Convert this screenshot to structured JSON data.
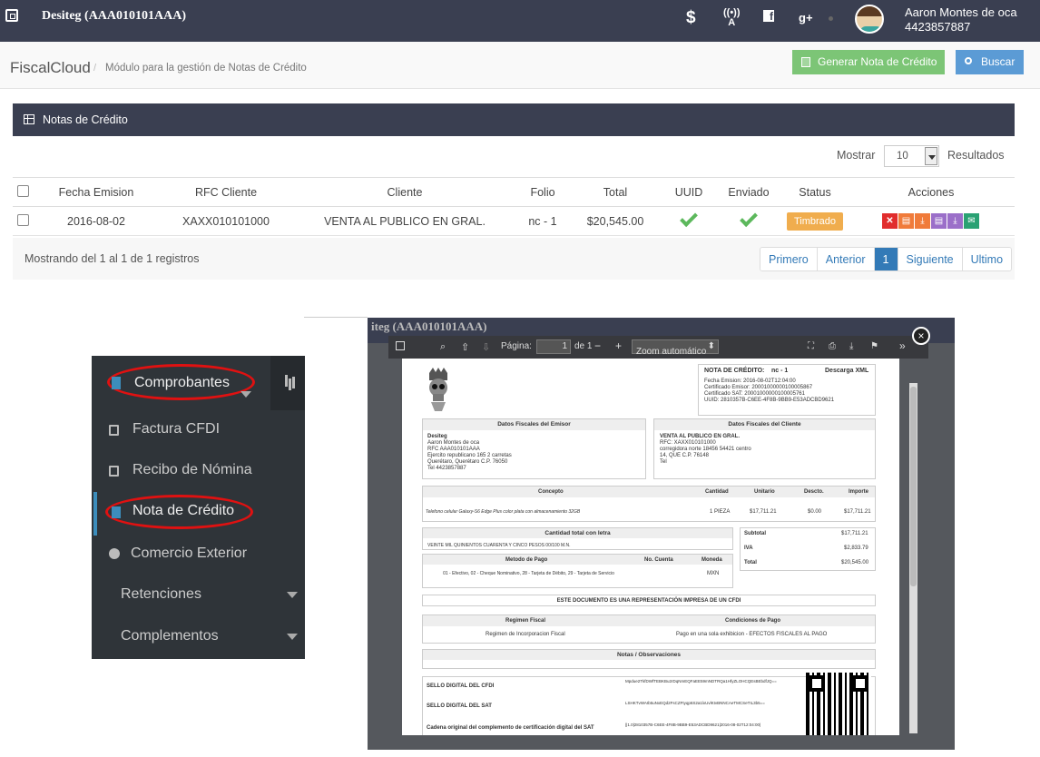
{
  "header": {
    "company": "Desiteg  (AAA010101AAA)",
    "user_name": "Aaron Montes de oca",
    "user_phone": "4423857887",
    "icons": [
      "expand-icon",
      "dollar-icon",
      "accessibility-icon",
      "facebook-icon",
      "google-plus-icon",
      "avatar"
    ]
  },
  "breadcrumb": {
    "app": "FiscalCloud",
    "sep": "/",
    "module": "Módulo para la gestión de Notas de Crédito"
  },
  "actions": {
    "generate": "Generar Nota de Crédito",
    "search": "Buscar"
  },
  "panel": {
    "title": "Notas de Crédito"
  },
  "length": {
    "label_before": "Mostrar",
    "value": "10",
    "label_after": "Resultados"
  },
  "table": {
    "columns": [
      "Fecha Emision",
      "RFC Cliente",
      "Cliente",
      "Folio",
      "Total",
      "UUID",
      "Enviado",
      "Status",
      "Acciones"
    ],
    "rows": [
      {
        "fecha": "2016-08-02",
        "rfc": "XAXX010101000",
        "cliente": "VENTA AL PUBLICO EN GRAL.",
        "folio": "nc - 1",
        "total": "$20,545.00",
        "status": "Timbrado"
      }
    ]
  },
  "info": "Mostrando del 1 al 1 de 1 registros",
  "pagination": [
    "Primero",
    "Anterior",
    "1",
    "Siguiente",
    "Ultimo"
  ],
  "sidebar": {
    "items": [
      "Comprobantes",
      "Factura CFDI",
      "Recibo de Nómina",
      "Nota de Crédito",
      "Comercio Exterior",
      "Retenciones",
      "Complementos"
    ]
  },
  "pdf_viewer": {
    "bg_title": "iteg  (AAA010101AAA)",
    "page_label": "Página:",
    "page_value": "1",
    "page_of": "de 1",
    "zoom": "Zoom automático",
    "close": "×"
  },
  "pdf_doc": {
    "nota_label": "NOTA DE CRÉDITO:",
    "nota_value": "nc - 1",
    "download": "Descarga XML",
    "fecha": "Fecha Emision: 2016-08-02T12:04:00",
    "cert_emisor": "Certificado Emisor: 20001000000100005867",
    "cert_sat": "Certificado SAT: 20001000000100005761",
    "uuid": "UUID: 2810357B-C6EE-4F8B-9BB9-E53ADCBD9621",
    "emisor_title": "Datos Fiscales del Emisor",
    "emisor_lines": [
      "Desiteg",
      "Aaron Montes de oca",
      "RFC AAA010101AAA",
      "Ejercito republicano 165 2 carretas",
      "Querétaro, Querétaro C.P. 76050",
      "Tel 4423857887"
    ],
    "cliente_title": "Datos Fiscales del Cliente",
    "cliente_lines": [
      "VENTA AL PUBLICO EN GRAL.",
      "RFC: XAXX010101000",
      "corregidora norte 18456 54421 centro",
      "14, QUE C.P. 76148",
      "Tel"
    ],
    "concept_headers": [
      "Concepto",
      "Cantidad",
      "Unitario",
      "Descto.",
      "Importe"
    ],
    "concept_row": [
      "Telefono celular Galaxy-S6 Edge Plus color plata con almacenamiento 32GB",
      "1 PIEZA",
      "$17,711.21",
      "$0.00",
      "$17,711.21"
    ],
    "letra_title": "Cantidad total con letra",
    "letra": "VEINTE MIL QUINIENTOS CUARENTA Y CINCO PESOS 00/100 M.N.",
    "subtotal_label": "Subtotal",
    "subtotal": "$17,711.21",
    "iva_label": "IVA",
    "iva": "$2,833.79",
    "total_label": "Total",
    "total": "$20,545.00",
    "pago_headers": [
      "Metodo de Pago",
      "No. Cuenta",
      "Moneda"
    ],
    "pago_row": [
      "01 - Efectivo, 02 - Cheque Nominativo, 28 - Tarjeta de Débito, 29 - Tarjeta de Servicio",
      "",
      "MXN"
    ],
    "representacion": "ESTE DOCUMENTO ES UNA REPRESENTACIÓN IMPRESA DE UN CFDI",
    "regimen_title": "Regimen Fiscal",
    "regimen": "Regimen de Incorporacion Fiscal",
    "condiciones_title": "Condiciones de Pago",
    "condiciones": "Pago en una sola exhibicion - EFECTOS FISCALES AL PAGO",
    "notas_title": "Notas / Observaciones",
    "sello_cfdi": "SELLO DIGITAL DEL CFDI",
    "sello_sat": "SELLO DIGITAL DEL SAT",
    "cadena": "Cadena original del complemento de certificación digital del SAT",
    "sello_cfdi_text": "Mpdue2TkfDWfTEBKBu2rDqNmEQFaEE59mNDTRQa1HfyZLOHCQEsBEbdfJQ==",
    "sello_sat_text": "LSHKTvWAIb5uNxEQd2FsCZFtyqp6S2a1lxUvlKtvBNNCAeTMCSeTIL3b5==",
    "cadena_text": "||1.0|2810357B-C6EE-4F8B-9BB9-E53ADCBD9621|2016-08-02T12:04:00|"
  },
  "colors": {
    "header_bg": "#3a3f51",
    "green": "#7cc576",
    "blue": "#5b9bd5",
    "badge": "#f0ad4e",
    "active": "#337ab7"
  }
}
